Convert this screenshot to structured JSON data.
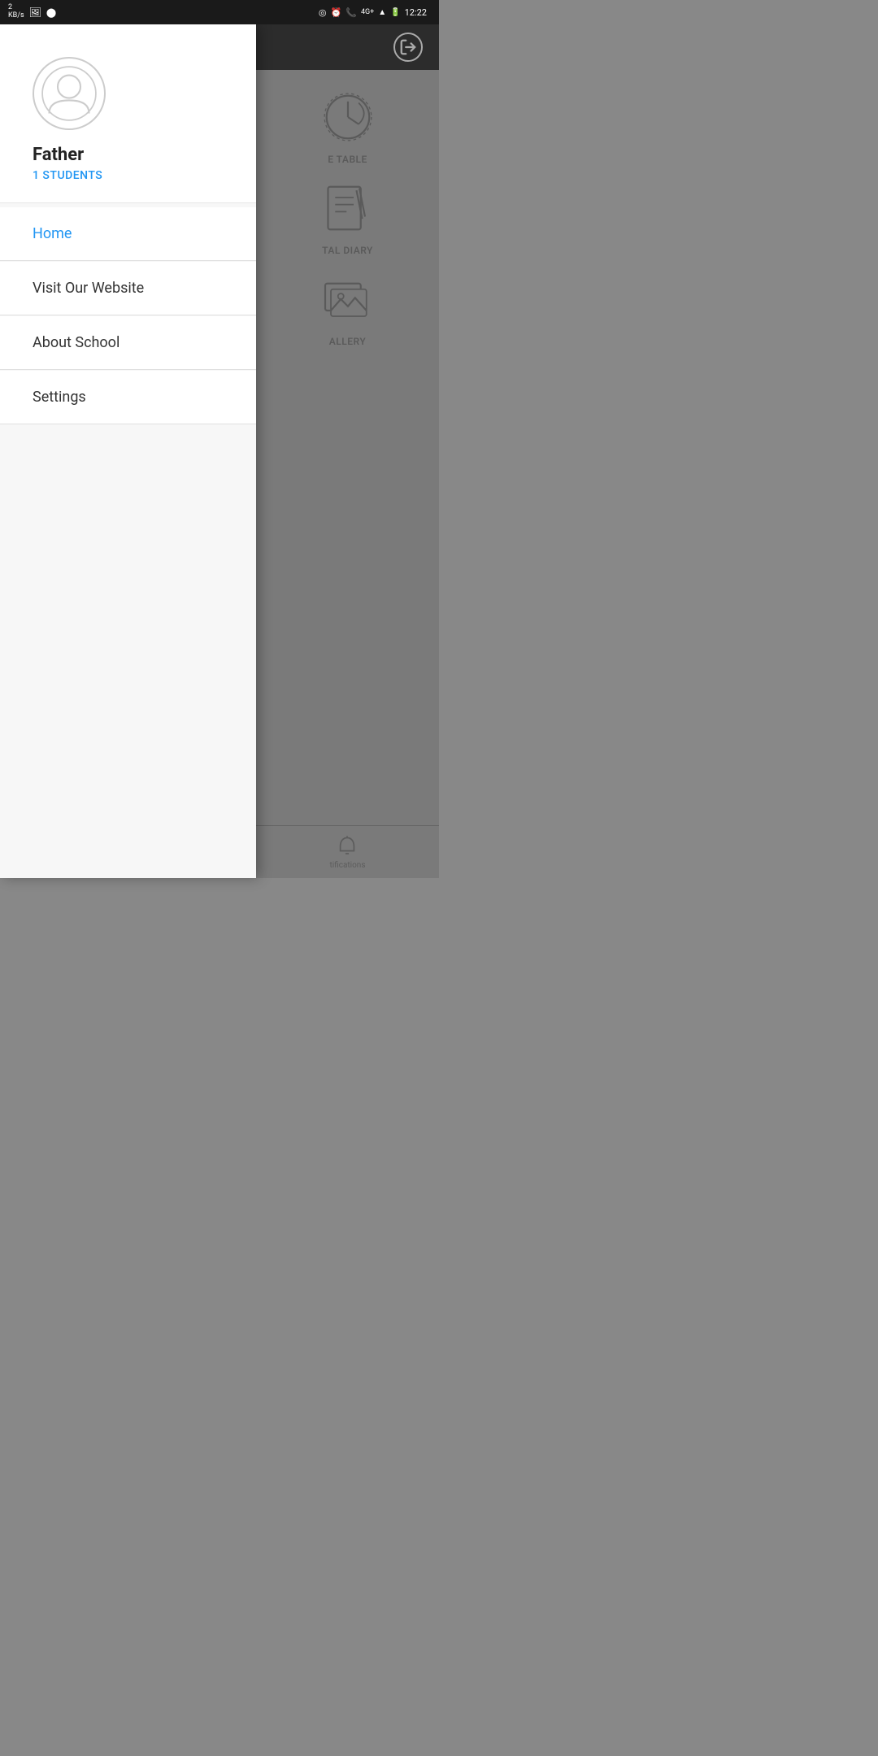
{
  "statusBar": {
    "leftItems": [
      {
        "id": "speed",
        "text": "2\nKB/s"
      },
      {
        "id": "image-icon",
        "symbol": "🖼"
      },
      {
        "id": "circle-icon",
        "symbol": "⬤"
      }
    ],
    "rightItems": [
      {
        "id": "location-icon",
        "symbol": "◎"
      },
      {
        "id": "alarm-icon",
        "symbol": "⏰"
      },
      {
        "id": "phone-icon",
        "symbol": "📞"
      },
      {
        "id": "signal-text",
        "text": "4G+"
      },
      {
        "id": "signal-bars",
        "symbol": "▂▄▆"
      },
      {
        "id": "battery",
        "text": "61%"
      },
      {
        "id": "time",
        "text": "12:22"
      }
    ]
  },
  "drawer": {
    "user": {
      "name": "Father",
      "students": "1 STUDENTS"
    },
    "menuItems": [
      {
        "id": "home",
        "label": "Home",
        "active": true
      },
      {
        "id": "visit-website",
        "label": "Visit Our Website",
        "active": false
      },
      {
        "id": "about-school",
        "label": "About School",
        "active": false
      },
      {
        "id": "settings",
        "label": "Settings",
        "active": false
      }
    ]
  },
  "appContent": {
    "header": {
      "logoutIcon": "logout"
    },
    "gridItems": [
      {
        "id": "timetable",
        "label": "E TABLE"
      },
      {
        "id": "diary",
        "label": "TAL DIARY"
      },
      {
        "id": "gallery",
        "label": "ALLERY"
      }
    ],
    "bottomNav": {
      "label": "tifications"
    }
  }
}
